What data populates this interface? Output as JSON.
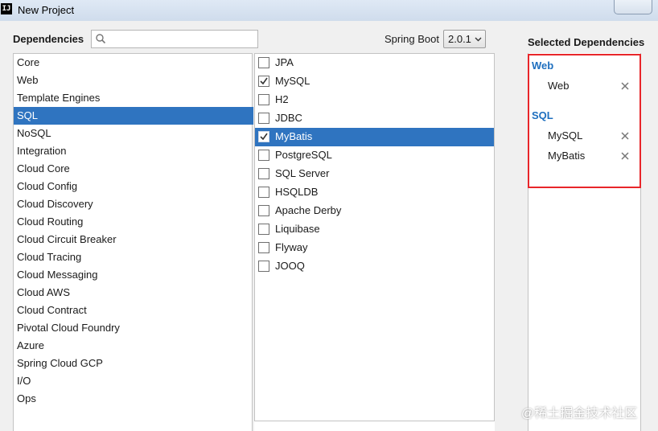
{
  "window": {
    "title": "New Project",
    "app_icon_text": "IJ"
  },
  "header": {
    "dependencies_label": "Dependencies",
    "search": {
      "value": "",
      "placeholder": ""
    },
    "spring_boot_label": "Spring Boot",
    "spring_boot_version": "2.0.1"
  },
  "categories": [
    {
      "label": "Core"
    },
    {
      "label": "Web"
    },
    {
      "label": "Template Engines"
    },
    {
      "label": "SQL"
    },
    {
      "label": "NoSQL"
    },
    {
      "label": "Integration"
    },
    {
      "label": "Cloud Core"
    },
    {
      "label": "Cloud Config"
    },
    {
      "label": "Cloud Discovery"
    },
    {
      "label": "Cloud Routing"
    },
    {
      "label": "Cloud Circuit Breaker"
    },
    {
      "label": "Cloud Tracing"
    },
    {
      "label": "Cloud Messaging"
    },
    {
      "label": "Cloud AWS"
    },
    {
      "label": "Cloud Contract"
    },
    {
      "label": "Pivotal Cloud Foundry"
    },
    {
      "label": "Azure"
    },
    {
      "label": "Spring Cloud GCP"
    },
    {
      "label": "I/O"
    },
    {
      "label": "Ops"
    }
  ],
  "selected_category": "SQL",
  "dependencies": [
    {
      "label": "JPA",
      "checked": false
    },
    {
      "label": "MySQL",
      "checked": true
    },
    {
      "label": "H2",
      "checked": false
    },
    {
      "label": "JDBC",
      "checked": false
    },
    {
      "label": "MyBatis",
      "checked": true
    },
    {
      "label": "PostgreSQL",
      "checked": false
    },
    {
      "label": "SQL Server",
      "checked": false
    },
    {
      "label": "HSQLDB",
      "checked": false
    },
    {
      "label": "Apache Derby",
      "checked": false
    },
    {
      "label": "Liquibase",
      "checked": false
    },
    {
      "label": "Flyway",
      "checked": false
    },
    {
      "label": "JOOQ",
      "checked": false
    }
  ],
  "selected_dependency": "MyBatis",
  "selected_panel": {
    "title": "Selected Dependencies",
    "groups": [
      {
        "name": "Web",
        "items": [
          {
            "label": "Web"
          }
        ]
      },
      {
        "name": "SQL",
        "items": [
          {
            "label": "MySQL"
          },
          {
            "label": "MyBatis"
          }
        ]
      }
    ],
    "remove_symbol": "✕"
  },
  "watermark": "@稀土掘金技术社区",
  "colors": {
    "selection": "#2f74c0",
    "group_title": "#1e6fbf",
    "highlight_border": "#e8262a"
  }
}
